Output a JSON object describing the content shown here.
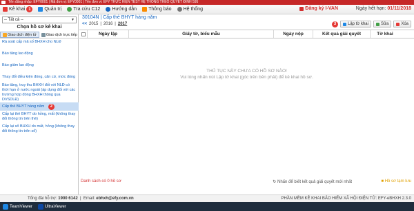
{
  "titlebar": {
    "text": "Tên đăng nhập: EFY0001 | Mã đơn vị: EFY0001 | Tên đơn vị: EFY THỰC HIỆN TEST HỆ THỐNG THEO QUYẾT ĐỊNH 595"
  },
  "menu": {
    "items": [
      {
        "label": "Kê khai",
        "icon": "document-icon",
        "color": "#e53935",
        "marker": "1"
      },
      {
        "label": "Quản trị",
        "icon": "users-icon",
        "color": "#1e88e5"
      },
      {
        "label": "Tra cứu C12",
        "icon": "search-icon",
        "color": "#43a047"
      },
      {
        "label": "Hướng dẫn",
        "icon": "help-icon",
        "color": "#1565c0"
      },
      {
        "label": "Thông báo",
        "icon": "bell-icon",
        "color": "#fb8c00"
      },
      {
        "label": "Hệ thống",
        "icon": "gear-icon",
        "color": "#757575"
      }
    ],
    "register_label": "Đăng ký I-VAN",
    "expiry_label": "Ngày hết hạn:",
    "expiry_date": "01/11/2018"
  },
  "sidebar": {
    "select_value": "-- Tất cả --",
    "heading": "Chọn hồ sơ kê khai",
    "tabs": [
      {
        "label": "Giao dịch điện tử",
        "icon": "folder-icon"
      },
      {
        "label": "Giao dịch trực tiếp",
        "icon": "document-icon"
      }
    ],
    "items": [
      {
        "label": "Rà soát cấp mã số BHXH cho NLĐ"
      },
      {
        "label": "Báo tăng lao động"
      },
      {
        "label": "Báo giảm lao động"
      },
      {
        "label": "Thay đổi điều kiện đóng, căn cứ, mức đóng"
      },
      {
        "label": "Báo tăng, truy thu BHXH đối với NLĐ có thời hạn ở nước ngoài (áp dụng đối với các trường hợp đóng BHXH thông qua DVSDLĐ)"
      },
      {
        "label": "Cấp thẻ BHYT hàng năm",
        "marker": "2"
      },
      {
        "label": "Cấp lại thẻ BHYT do hỏng, mất (không thay đổi thông tin trên thẻ)"
      },
      {
        "label": "Cấp lại sổ BHXH do mất, hỏng (không thay đổi thông tin trên sổ)"
      }
    ]
  },
  "main": {
    "title": "30104N | Cấp thẻ BHYT hàng năm",
    "year_nav_prev": "<<",
    "years": [
      "2015",
      "2016",
      "2017"
    ],
    "action_marker": "3",
    "actions": [
      {
        "label": "Lập tờ khai",
        "icon": "add-document-icon"
      },
      {
        "label": "Sửa",
        "icon": "edit-icon"
      },
      {
        "label": "Xóa",
        "icon": "delete-icon"
      }
    ],
    "columns": [
      "Ngày lập",
      "Giấy tờ, biểu mẫu",
      "Ngày nộp",
      "Kết quả giải quyết",
      "Tờ khai"
    ],
    "empty_line1": "THỦ TỤC NÀY CHƯA CÓ HỒ SƠ NÀO!",
    "empty_line2": "Vui lòng nhấn nút Lập tờ khai (góc trên bên phải) để kê khai hồ sơ.",
    "footer_count": "Danh sách có 0 hồ sơ",
    "footer_note1": "Nhấn để biết kết quả giải quyết mới nhất",
    "footer_note2": "Hồ sơ tạm lưu"
  },
  "statusbar": {
    "support_label": "Tổng đài hỗ trợ:",
    "support_phone": "1900 6142",
    "email_label": "Email:",
    "email": "ebhxh@efy.com.vn",
    "version": "PHẦN MỀM KÊ KHAI BẢO HIỂM XÃ HỘI ĐIỆN TỬ: EFY-eBHXH 2.3.0"
  },
  "taskbar": {
    "items": [
      {
        "label": "TeamViewer"
      },
      {
        "label": "UltraViewer"
      }
    ]
  }
}
